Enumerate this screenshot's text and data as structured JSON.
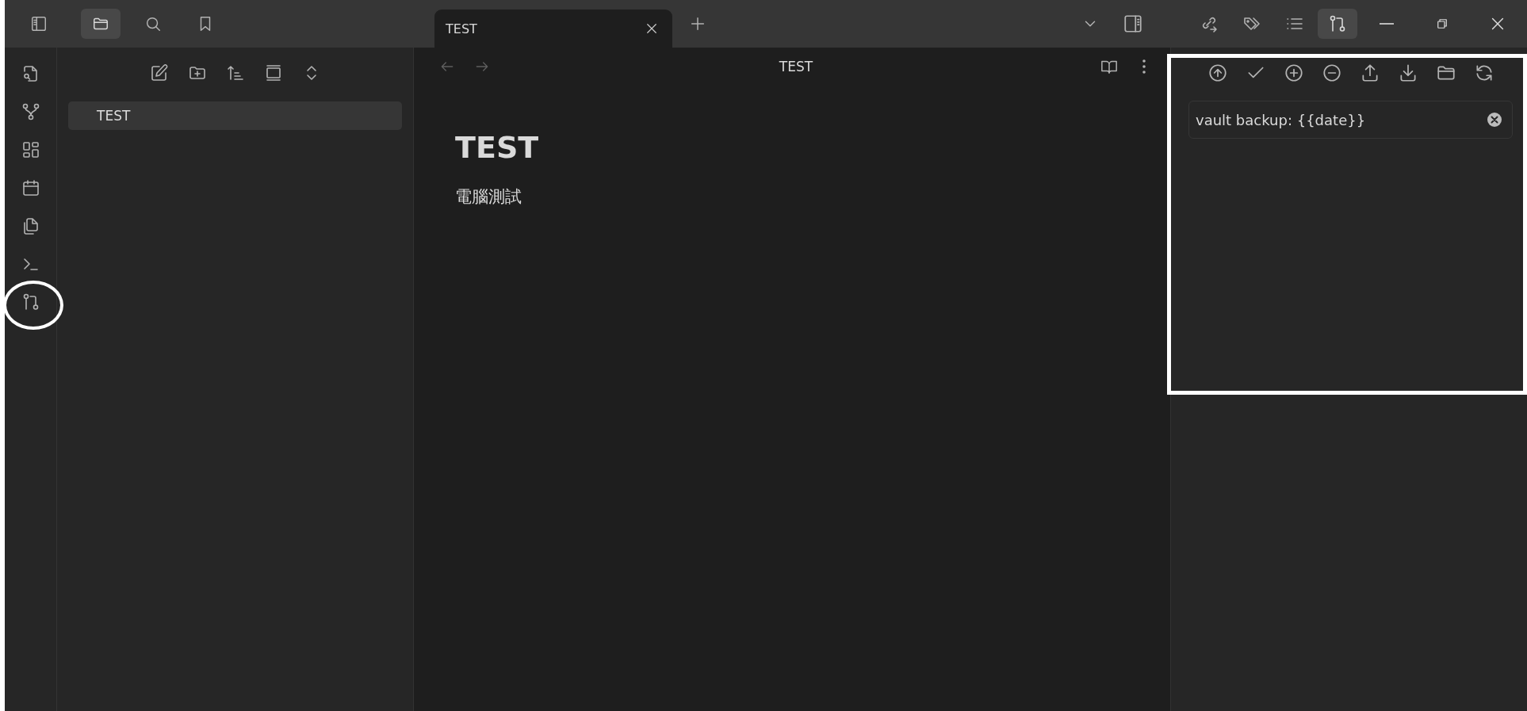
{
  "left_header_buttons": [
    {
      "selected": false
    },
    {
      "selected": true
    },
    {
      "selected": false
    },
    {
      "selected": false
    }
  ],
  "tabs": [
    {
      "label": "TEST",
      "selected": true
    }
  ],
  "right_header_buttons": [
    {
      "selected": false
    },
    {
      "selected": false
    },
    {
      "selected": false
    },
    {
      "selected": true
    }
  ],
  "file_explorer": {
    "items": [
      {
        "name": "TEST",
        "selected": true
      }
    ]
  },
  "editor": {
    "view_title": "TEST",
    "heading": "TEST",
    "body": "電腦測試"
  },
  "git_panel": {
    "commit_message": {
      "value": "vault backup: {{date}}"
    }
  }
}
